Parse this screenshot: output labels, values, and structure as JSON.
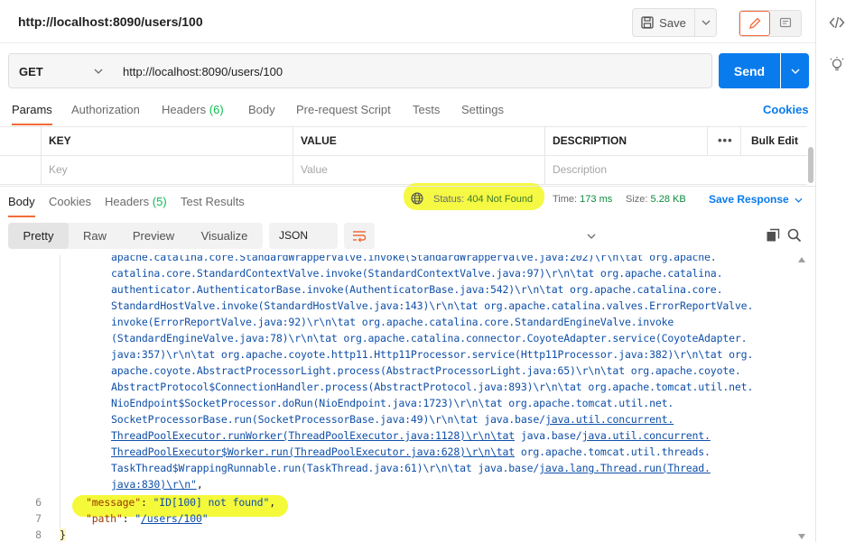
{
  "request": {
    "title": "http://localhost:8090/users/100",
    "save_label": "Save",
    "method": "GET",
    "url": "http://localhost:8090/users/100",
    "send_label": "Send"
  },
  "request_tabs": {
    "params": "Params",
    "authorization": "Authorization",
    "headers": "Headers",
    "headers_count": "(6)",
    "body": "Body",
    "pre_request": "Pre-request Script",
    "tests": "Tests",
    "settings": "Settings",
    "cookies": "Cookies"
  },
  "params_table": {
    "columns": [
      "KEY",
      "VALUE",
      "DESCRIPTION"
    ],
    "more": "•••",
    "bulk_edit": "Bulk Edit",
    "placeholders": [
      "Key",
      "Value",
      "Description"
    ]
  },
  "response_tabs": {
    "body": "Body",
    "cookies": "Cookies",
    "headers": "Headers",
    "headers_count": "(5)",
    "test_results": "Test Results"
  },
  "response_meta": {
    "status_label": "Status:",
    "status_value": "404 Not Found",
    "time_label": "Time:",
    "time_value": "173 ms",
    "size_label": "Size:",
    "size_value": "5.28 KB",
    "save_response": "Save Response"
  },
  "body_view": {
    "modes": [
      "Pretty",
      "Raw",
      "Preview",
      "Visualize"
    ],
    "active_mode": "Pretty",
    "format": "JSON"
  },
  "code": {
    "trace_lines": [
      "apache.catalina.core.StandardWrapperValve.invoke(StandardWrapperValve.java:202)\\r\\n\\tat org.apache.",
      "catalina.core.StandardContextValve.invoke(StandardContextValve.java:97)\\r\\n\\tat org.apache.catalina.",
      "authenticator.AuthenticatorBase.invoke(AuthenticatorBase.java:542)\\r\\n\\tat org.apache.catalina.core.",
      "StandardHostValve.invoke(StandardHostValve.java:143)\\r\\n\\tat org.apache.catalina.valves.ErrorReportValve.",
      "invoke(ErrorReportValve.java:92)\\r\\n\\tat org.apache.catalina.core.StandardEngineValve.invoke",
      "(StandardEngineValve.java:78)\\r\\n\\tat org.apache.catalina.connector.CoyoteAdapter.service(CoyoteAdapter.",
      "java:357)\\r\\n\\tat org.apache.coyote.http11.Http11Processor.service(Http11Processor.java:382)\\r\\n\\tat org.",
      "apache.coyote.AbstractProcessorLight.process(AbstractProcessorLight.java:65)\\r\\n\\tat org.apache.coyote.",
      "AbstractProtocol$ConnectionHandler.process(AbstractProtocol.java:893)\\r\\n\\tat org.apache.tomcat.util.net.",
      "NioEndpoint$SocketProcessor.doRun(NioEndpoint.java:1723)\\r\\n\\tat org.apache.tomcat.util.net."
    ],
    "line_10a": "SocketProcessorBase.run(SocketProcessorBase.java:49)\\r\\n\\tat java.base/",
    "line_10b": "java.util.concurrent.",
    "line_11a": "ThreadPoolExecutor.runWorker(ThreadPoolExecutor.java:1128)\\r\\n\\tat",
    "line_11b": " java.base/",
    "line_11c": "java.util.concurrent.",
    "line_12a": "ThreadPoolExecutor$Worker.run(ThreadPoolExecutor.java:628)\\r\\n\\tat",
    "line_12b": " org.apache.tomcat.util.threads.",
    "line_13a": "TaskThread$WrappingRunnable.run(TaskThread.java:61)\\r\\n\\tat java.base/",
    "line_13b": "java.lang.Thread.run(Thread.",
    "line_14a": "java:830)\\r\\n\"",
    "line_14b": ",",
    "line6_num": "6",
    "line6_key": "\"message\"",
    "line6_colon": ": ",
    "line6_val": "\"ID[100] not found\"",
    "line6_comma": ",",
    "line7_num": "7",
    "line7_key": "\"path\"",
    "line7_colon": ": ",
    "line7_val_q1": "\"",
    "line7_val": "/users/100",
    "line7_val_q2": "\"",
    "line8_num": "8",
    "line8_brace": "}"
  },
  "colors": {
    "accent": "#f26b3a",
    "send_blue": "#097bed",
    "highlight": "#f4f93a",
    "count_green": "#0cbb52"
  }
}
